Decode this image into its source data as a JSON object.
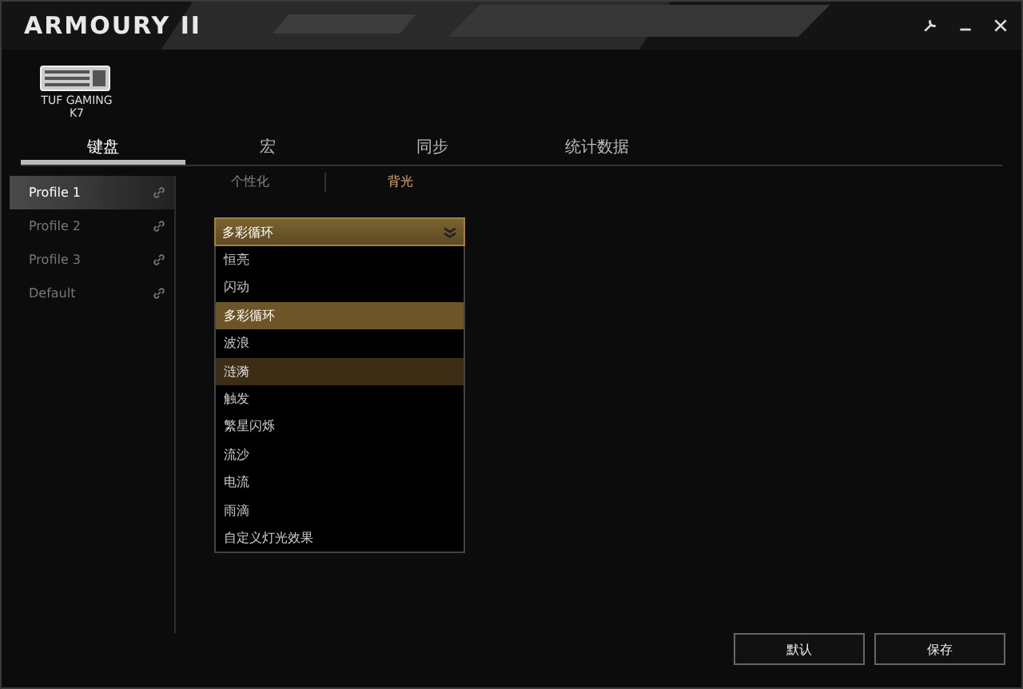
{
  "window": {
    "title": "ARMOURY II"
  },
  "device": {
    "name": "TUF GAMING K7"
  },
  "tabs": [
    {
      "label": "键盘",
      "selected": true
    },
    {
      "label": "宏",
      "selected": false
    },
    {
      "label": "同步",
      "selected": false
    },
    {
      "label": "统计数据",
      "selected": false
    }
  ],
  "profiles": [
    {
      "label": "Profile 1",
      "selected": true
    },
    {
      "label": "Profile 2",
      "selected": false
    },
    {
      "label": "Profile 3",
      "selected": false
    },
    {
      "label": "Default",
      "selected": false
    }
  ],
  "subtabs": [
    {
      "label": "个性化",
      "selected": false
    },
    {
      "label": "背光",
      "selected": true
    }
  ],
  "effect_dropdown": {
    "value": "多彩循环",
    "expanded": true,
    "options": [
      {
        "label": "恒亮",
        "selected": false,
        "hovered": false
      },
      {
        "label": "闪动",
        "selected": false,
        "hovered": false
      },
      {
        "label": "多彩循环",
        "selected": true,
        "hovered": false
      },
      {
        "label": "波浪",
        "selected": false,
        "hovered": false
      },
      {
        "label": "涟漪",
        "selected": false,
        "hovered": true
      },
      {
        "label": "触发",
        "selected": false,
        "hovered": false
      },
      {
        "label": "繁星闪烁",
        "selected": false,
        "hovered": false
      },
      {
        "label": "流沙",
        "selected": false,
        "hovered": false
      },
      {
        "label": "电流",
        "selected": false,
        "hovered": false
      },
      {
        "label": "雨滴",
        "selected": false,
        "hovered": false
      },
      {
        "label": "自定义灯光效果",
        "selected": false,
        "hovered": false
      }
    ]
  },
  "buttons": [
    "默认",
    "保存"
  ]
}
